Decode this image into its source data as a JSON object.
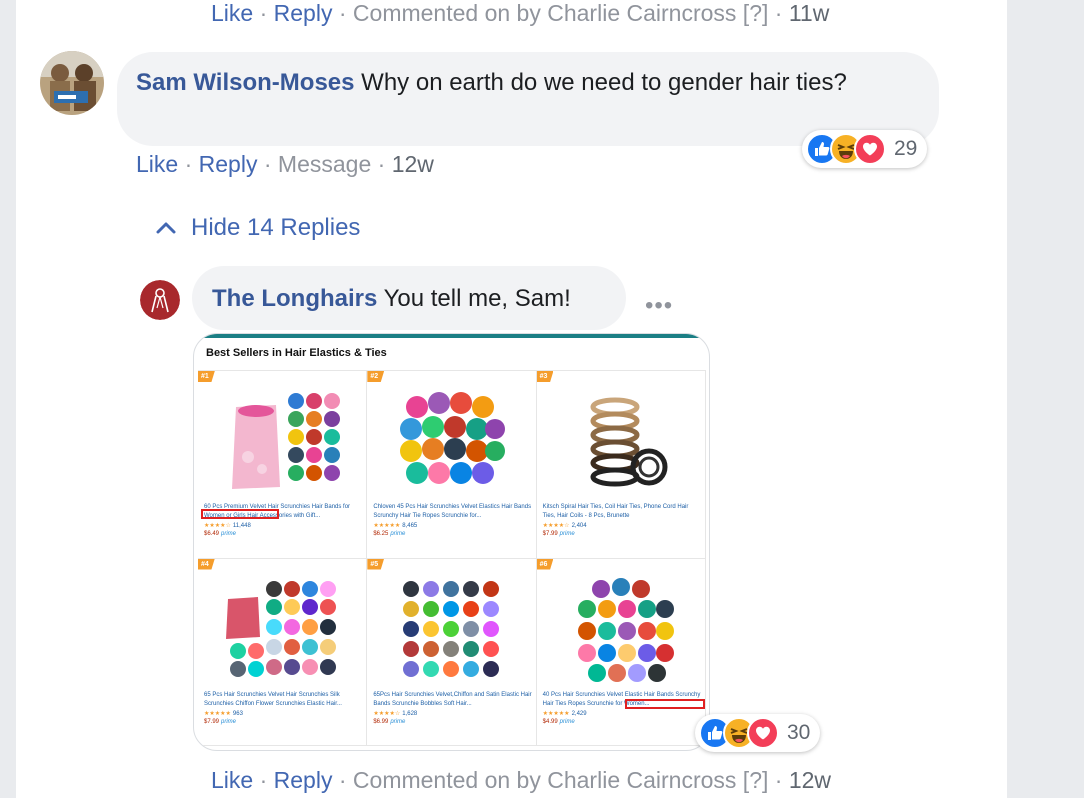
{
  "top_actions": {
    "like": "Like",
    "reply": "Reply",
    "commented_on": "Commented on by Charlie Cairncross [?]",
    "time": "11w"
  },
  "comment": {
    "author": "Sam Wilson-Moses",
    "text": "Why on earth do we need to gender hair ties?",
    "reactions_count": "29",
    "actions": {
      "like": "Like",
      "reply": "Reply",
      "message": "Message",
      "time": "12w"
    }
  },
  "hide_replies_label": "Hide 14 Replies",
  "reply": {
    "author": "The Longhairs",
    "text": "You tell me, Sam!",
    "more_label": "•••",
    "reactions_count": "30",
    "actions": {
      "like": "Like",
      "reply": "Reply",
      "commented_on": "Commented on by Charlie Cairncross [?]",
      "time": "12w"
    }
  },
  "attachment": {
    "title": "Best Sellers in Hair Elastics & Ties",
    "products": [
      {
        "rank": "#1",
        "title": "60 Pcs Premium Velvet Hair Scrunchies Hair Bands for Women or Girls Hair Accessories with Gift...",
        "rating_count": "11,448",
        "price": "$6.49",
        "prime": "prime"
      },
      {
        "rank": "#2",
        "title": "Chloven 45 Pcs Hair Scrunchies Velvet Elastics Hair Bands Scrunchy Hair Tie Ropes Scrunchie for...",
        "rating_count": "8,465",
        "price": "$6.25",
        "prime": "prime"
      },
      {
        "rank": "#3",
        "title": "Kitsch Spiral Hair Ties, Coil Hair Ties, Phone Cord Hair Ties, Hair Coils - 8 Pcs, Brunette",
        "rating_count": "2,404",
        "price": "$7.99",
        "prime": "prime"
      },
      {
        "rank": "#4",
        "title": "65 Pcs Hair Scrunchies Velvet Hair Scrunchies Silk Scrunchies Chiffon Flower Scrunchies Elastic Hair...",
        "rating_count": "963",
        "price": "$7.99",
        "prime": "prime"
      },
      {
        "rank": "#5",
        "title": "65Pcs Hair Scrunchies Velvet,Chiffon and Satin Elastic Hair Bands Scrunchie Bobbles Soft Hair...",
        "rating_count": "1,628",
        "price": "$6.99",
        "prime": "prime"
      },
      {
        "rank": "#6",
        "title": "40 Pcs Hair Scrunchies Velvet Elastic Hair Bands Scrunchy Hair Ties Ropes Scrunchie for Women...",
        "rating_count": "2,429",
        "price": "$4.99",
        "prime": "prime"
      }
    ]
  },
  "icons": {
    "like": "thumbs-up-icon",
    "haha": "laughing-face-icon",
    "love": "heart-icon",
    "collapse": "chevron-up-icon"
  },
  "colors": {
    "link": "#4267b2",
    "author": "#385898",
    "bubble": "#f2f3f5",
    "like_reaction": "#1877f2",
    "love_reaction": "#f33e58",
    "haha_reaction": "#f7b125"
  }
}
